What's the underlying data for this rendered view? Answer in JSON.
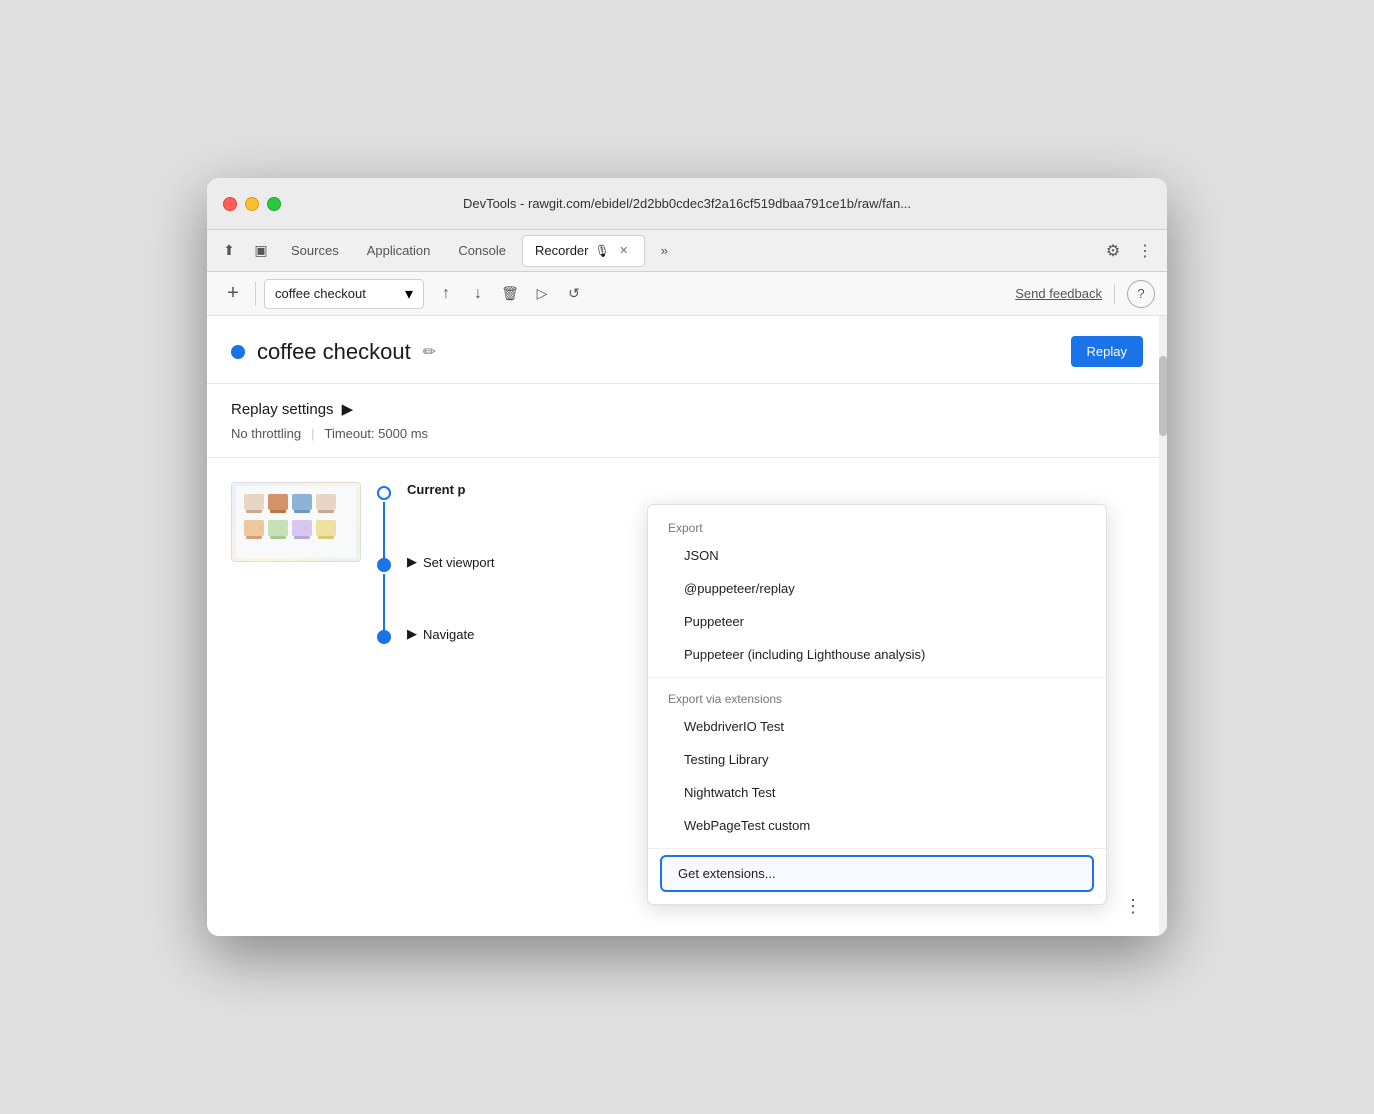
{
  "window": {
    "title": "DevTools - rawgit.com/ebidel/2d2bb0cdec3f2a16cf519dbaa791ce1b/raw/fan..."
  },
  "tabs": [
    {
      "id": "sources",
      "label": "Sources",
      "active": false
    },
    {
      "id": "application",
      "label": "Application",
      "active": false
    },
    {
      "id": "console",
      "label": "Console",
      "active": false
    },
    {
      "id": "recorder",
      "label": "Recorder",
      "active": true,
      "closeable": true
    }
  ],
  "toolbar": {
    "add_label": "+",
    "recording_name": "coffee checkout",
    "send_feedback": "Send feedback"
  },
  "recording": {
    "title": "coffee checkout",
    "dot_color": "#1a73e8",
    "replay_label": "Replay"
  },
  "replay_settings": {
    "label": "Replay settings",
    "throttling": "No throttling",
    "timeout": "Timeout: 5000 ms"
  },
  "dropdown": {
    "export_label": "Export",
    "export_items": [
      {
        "id": "json",
        "label": "JSON"
      },
      {
        "id": "puppeteer-replay",
        "label": "@puppeteer/replay"
      },
      {
        "id": "puppeteer",
        "label": "Puppeteer"
      },
      {
        "id": "puppeteer-lighthouse",
        "label": "Puppeteer (including Lighthouse analysis)"
      }
    ],
    "extensions_label": "Export via extensions",
    "extension_items": [
      {
        "id": "webdriverio",
        "label": "WebdriverIO Test"
      },
      {
        "id": "testing-library",
        "label": "Testing Library"
      },
      {
        "id": "nightwatch",
        "label": "Nightwatch Test"
      },
      {
        "id": "webpagetest",
        "label": "WebPageTest custom"
      }
    ],
    "get_extensions": "Get extensions..."
  },
  "timeline": {
    "items": [
      {
        "id": "current-page",
        "label": "Current page",
        "has_thumbnail": true
      },
      {
        "id": "set-viewport",
        "label": "Set viewport",
        "expanded": false
      },
      {
        "id": "navigate",
        "label": "Navigate",
        "expanded": false
      }
    ]
  },
  "icons": {
    "close": "✕",
    "chevron_down": "▾",
    "chevron_right": "▶",
    "edit": "✏",
    "upload": "↑",
    "download": "↓",
    "trash": "🗑",
    "play": "▷",
    "replay": "↺",
    "more": "⋮",
    "gear": "⚙",
    "help": "?",
    "back": "←",
    "cursor": "⬆",
    "forward_more": "»"
  }
}
